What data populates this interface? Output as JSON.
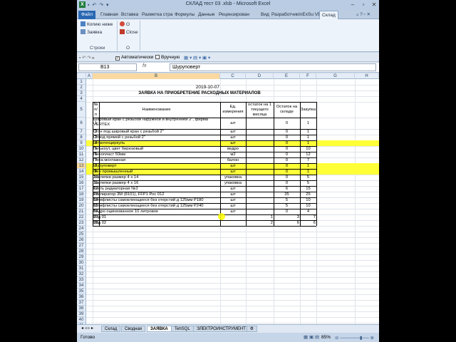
{
  "window": {
    "title": "СКЛАД тест 03 .xlsb - Microsoft Excel",
    "app_icon": "excel-icon",
    "controls": [
      "minimize-icon",
      "restore-icon",
      "close-icon"
    ]
  },
  "ribbon": {
    "tabs": [
      "Файл",
      "Главная",
      "Вставка",
      "Разметка стра",
      "Формулы",
      "Данные",
      "Рецензирован",
      "Вид",
      "Разработчик",
      "InExSu VBE",
      "Склад"
    ],
    "active_tab": "Склад",
    "group1": {
      "buttons": [
        "Копию ниже",
        "Заявка"
      ],
      "label": "Строки"
    },
    "group2": {
      "buttons": [
        "О",
        "Close"
      ],
      "label": "О"
    }
  },
  "toolbar": {
    "auto_label": "Автоматически",
    "manual_label": "Вручную"
  },
  "formula_bar": {
    "name_box": "B13",
    "fx": "fx",
    "value": "Шуруповерт"
  },
  "grid": {
    "columns": [
      "A",
      "B",
      "C",
      "D",
      "E",
      "F",
      "G",
      "H"
    ],
    "selected_column": "B",
    "selected_row": "13",
    "date": "2019-10-07",
    "heading": "ЗАЯВКА НА ПРИОБРЕТЕНИЕ РАСХОДНЫХ МАТЕРИАЛОВ",
    "headers": {
      "num": "№ п/п",
      "name": "Наименование",
      "unit": "Ед. измерения",
      "month_rest": "остаток на 1 текущего месяца",
      "stock": "Остаток на складе",
      "order": "Закупка"
    },
    "rows": [
      {
        "rn": "6",
        "n": "1",
        "name": "Шаровый кран с резьбой наружной и внутренней 2\", фирма VERTEX",
        "unit": "шт",
        "stock": "0",
        "order": "1",
        "hl": false
      },
      {
        "rn": "7",
        "n": "2",
        "name": "Сгон под шаровый кран с резьбой 2\"",
        "unit": "шт",
        "stock": "0",
        "order": "1",
        "hl": false
      },
      {
        "rn": "8",
        "n": "3",
        "name": "Отвод прямой с резьбой 2\"",
        "unit": "шт",
        "stock": "0",
        "order": "1",
        "hl": false
      },
      {
        "rn": "9",
        "n": "4",
        "name": "Штангенциркуль",
        "unit": "шт",
        "stock": "0",
        "order": "1",
        "hl": true
      },
      {
        "rn": "10",
        "n": "5",
        "name": "Гелькоут, цвет бирюзовый",
        "unit": "ведро",
        "stock": "0",
        "order": "10",
        "hl": false
      },
      {
        "rn": "11",
        "n": "6",
        "name": "Пенопласт 50мм",
        "unit": "м2",
        "stock": "0",
        "order": "12",
        "hl": false
      },
      {
        "rn": "12",
        "n": "7",
        "name": "Пена монтажная",
        "unit": "балон",
        "stock": "0",
        "order": "7",
        "hl": false
      },
      {
        "rn": "13",
        "n": "8",
        "name": "Шуруповерт",
        "unit": "шт",
        "stock": "0",
        "order": "1",
        "hl": true
      },
      {
        "rn": "14",
        "n": "9",
        "name": "Фен промышленный",
        "unit": "шт",
        "stock": "0",
        "order": "1",
        "hl": true
      },
      {
        "rn": "15",
        "n": "10",
        "name": "Заклепки размер 4 х 14",
        "unit": "упаковка",
        "stock": "0",
        "order": "5",
        "hl": false
      },
      {
        "rn": "16",
        "n": "11",
        "name": "Заклепки размер 4 х 16",
        "unit": "упаковка",
        "stock": "0",
        "order": "5",
        "hl": false
      },
      {
        "rn": "17",
        "n": "12",
        "name": "Кисть радиаторная №3",
        "unit": "шт",
        "stock": "6",
        "order": "15",
        "hl": false
      },
      {
        "rn": "18",
        "n": "13",
        "name": "Респиратор 3М (8101), FFP1 Рос 012",
        "unit": "шт",
        "stock": "35",
        "order": "25",
        "hl": false
      },
      {
        "rn": "19",
        "n": "14",
        "name": "Шлифлисты самоклеющиеся без отерстий д 125мм P180",
        "unit": "шт",
        "stock": "5",
        "order": "10",
        "hl": false
      },
      {
        "rn": "20",
        "n": "15",
        "name": "Шлифлисты самоклеющиеся без отерстий д 125мм P240",
        "unit": "шт",
        "stock": "5",
        "order": "10",
        "hl": false
      },
      {
        "rn": "21",
        "n": "16",
        "name": "Ведро оцинкованное 10 литровое",
        "unit": "шт",
        "stock": "0",
        "order": "4",
        "hl": false
      },
      {
        "rn": "22",
        "n": "17",
        "name": "Изд 01",
        "unit": "",
        "d": "1",
        "stock": "3",
        "order": "7",
        "hl": false
      },
      {
        "rn": "23",
        "n": "18",
        "name": "Изд 02",
        "unit": "",
        "d": "2",
        "stock": "6",
        "order": "6",
        "hl": false
      }
    ],
    "empty_rows": [
      "1",
      "2",
      "3",
      "4",
      "5",
      "24",
      "25",
      "26",
      "27",
      "28",
      "29",
      "30",
      "31",
      "32",
      "33",
      "34",
      "35",
      "36",
      "37",
      "38",
      "39",
      "40",
      "41",
      "42",
      "43",
      "44"
    ],
    "row_labels_top": [
      "1",
      "2",
      "3",
      "4",
      "5"
    ]
  },
  "sheets": {
    "tabs": [
      "Склад",
      "Сводная",
      "ЗАЯВКА",
      "TehSQL",
      "ЭЛЕКТРОИНСТРУМЕНТ",
      "Ф"
    ],
    "active": "ЗАЯВКА"
  },
  "status": {
    "ready": "Готово",
    "zoom": "85%"
  },
  "colors": {
    "highlight": "#ffff38",
    "ribbon_bg": "#edf3fa",
    "file_tab": "#2a68b3"
  }
}
